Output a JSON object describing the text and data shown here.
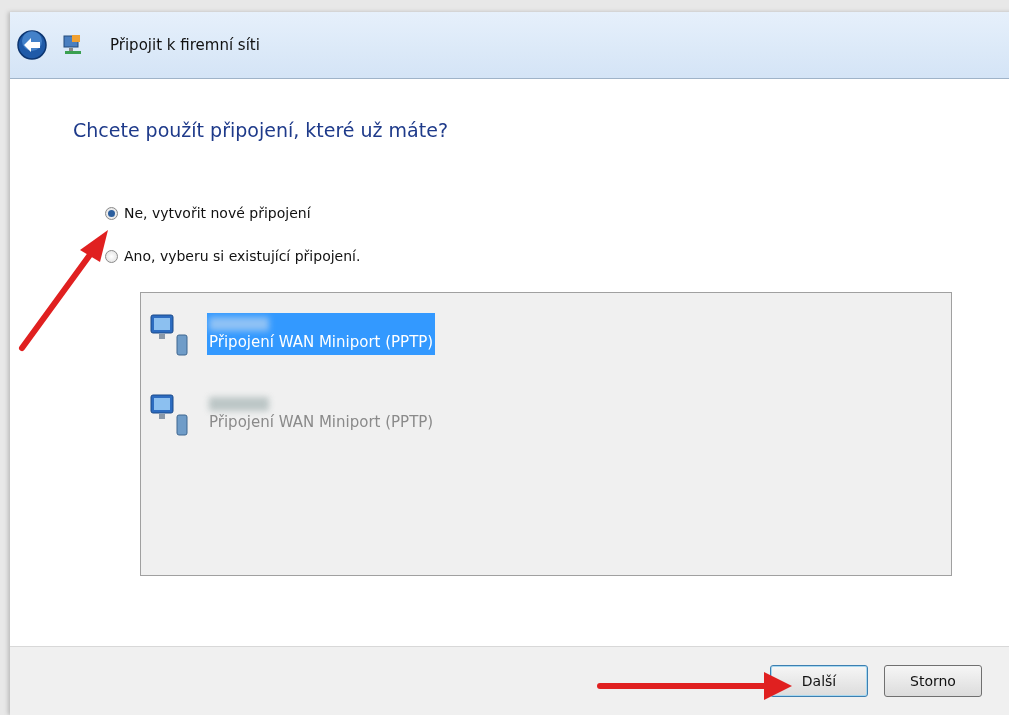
{
  "window": {
    "title": "Připojit k firemní síti"
  },
  "heading": "Chcete použít připojení, které už máte?",
  "options": [
    {
      "label": "Ne, vytvořit nové připojení",
      "selected": true
    },
    {
      "label": "Ano, vyberu si existující připojení.",
      "selected": false
    }
  ],
  "connections": [
    {
      "description": "Připojení WAN Miniport (PPTP)",
      "selected": true
    },
    {
      "description": "Připojení WAN Miniport (PPTP)",
      "selected": false
    }
  ],
  "buttons": [
    {
      "label": "Další",
      "default": true
    },
    {
      "label": "Storno",
      "default": false
    }
  ]
}
